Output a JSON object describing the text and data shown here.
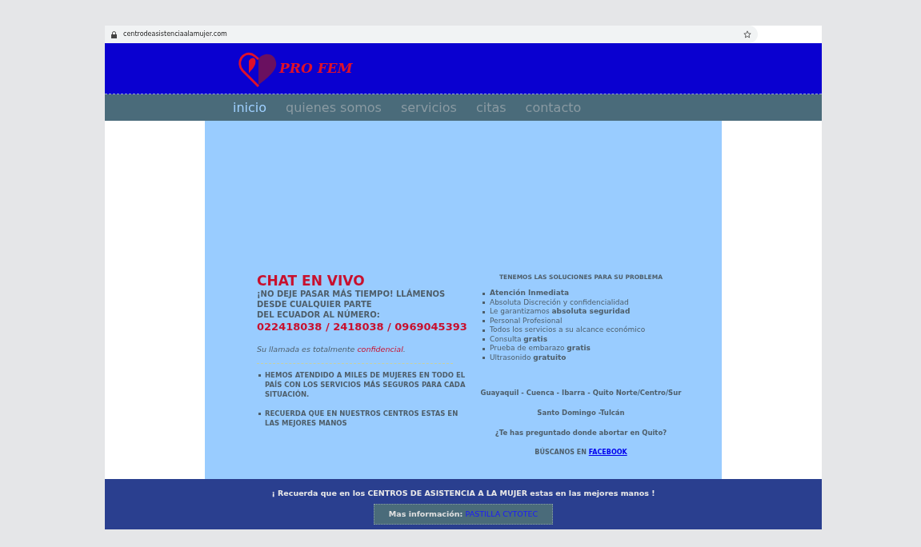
{
  "browser": {
    "url": "centrodeasistenciaalamujer.com"
  },
  "header": {
    "logo_text": "PRO FEM"
  },
  "nav": [
    {
      "label": "inicio",
      "selected": true
    },
    {
      "label": "quienes somos",
      "selected": false
    },
    {
      "label": "servicios",
      "selected": false
    },
    {
      "label": "citas",
      "selected": false
    },
    {
      "label": "contacto",
      "selected": false
    }
  ],
  "left": {
    "title": "CHAT EN VIVO",
    "subtitle_lines": [
      "¡NO DEJE PASAR MÁS TIEMPO! LLÁMENOS DESDE CUALQUIER PARTE",
      "DEL ECUADOR AL NÚMERO:"
    ],
    "phones": "022418038 / 2418038 / 0969045393",
    "note": "Su llamada es totalmente",
    "note_link": "confidencial",
    "note_end": ".",
    "bullets": [
      "HEMOS ATENDIDO A MILES DE MUJERES EN TODO EL PAÍS CON LOS SERVICIOS MÁS SEGUROS PARA CADA SITUACIÓN.",
      "RECUERDA QUE EN NUESTROS CENTROS ESTAS EN LAS MEJORES MANOS"
    ]
  },
  "right": {
    "heading": "TENEMOS LAS SOLUCIONES PARA SU PROBLEMA",
    "items": [
      "**Atención Inmediata**",
      "Absoluta Discreción y confidencialidad",
      "Le garantizamos **absoluta seguridad**",
      "Personal Profesional",
      "Todos los servicios a su alcance económico",
      "Consulta **gratis**",
      "Prueba de embarazo **gratis**",
      "Ultrasonido **gratuito**"
    ],
    "cities": "Guayaquil - Cuenca - Ibarra - Quito Norte/Centro/Sur",
    "cities_2": "Santo Domingo -Tulcán",
    "question": "¿Te has preguntado donde abortar en Quito?",
    "search_text": "BÚSCANOS EN",
    "search_link": "FACEBOOK"
  },
  "footer": {
    "message": "¡ Recuerda que en los CENTROS DE ASISTENCIA A LA MUJER estas en las mejores manos !",
    "more_label": "Mas información:",
    "more_link": "PASTILLA CYTOTEC"
  }
}
